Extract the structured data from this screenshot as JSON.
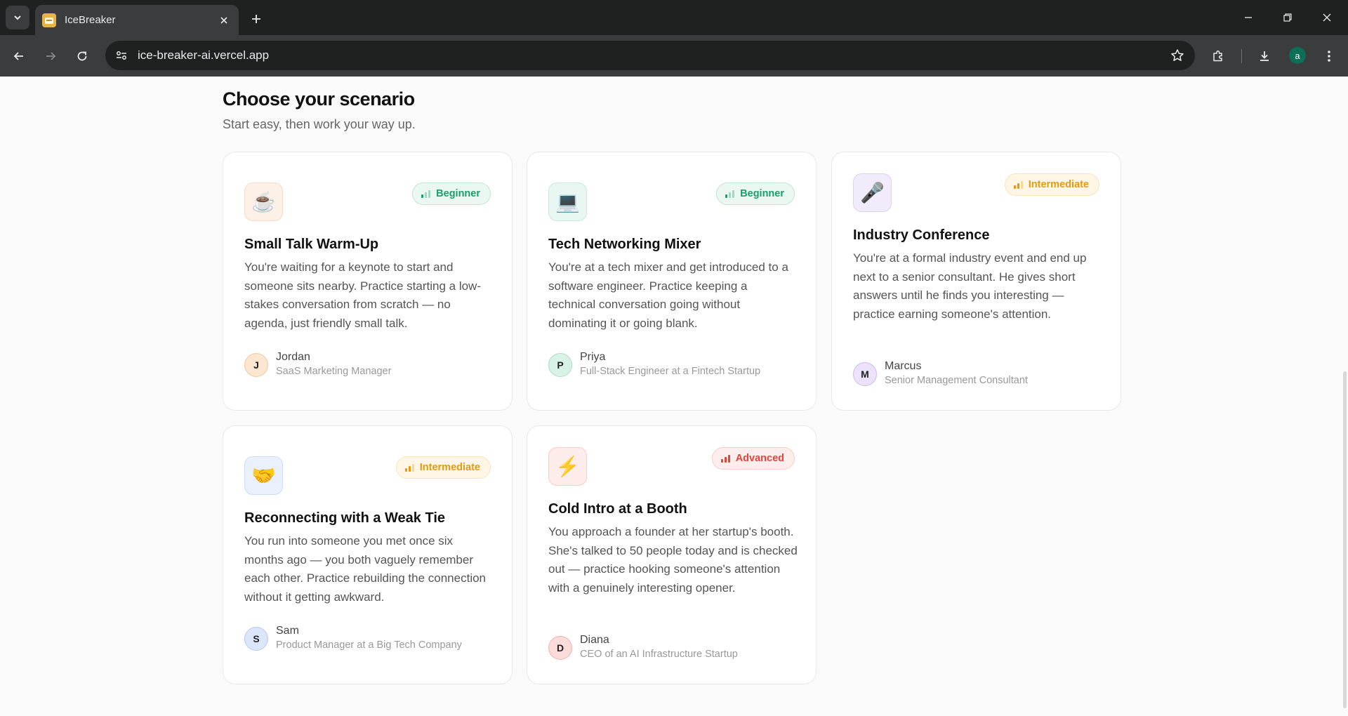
{
  "browser": {
    "tab_title": "IceBreaker",
    "url": "ice-breaker-ai.vercel.app",
    "profile_initial": "a"
  },
  "page": {
    "heading": "Choose your scenario",
    "subheading": "Start easy, then work your way up."
  },
  "scenarios": [
    {
      "icon": "coffee-cup-icon",
      "icon_glyph": "☕",
      "level": "Beginner",
      "title": "Small Talk Warm-Up",
      "description": "You're waiting for a keynote to start and someone sits nearby. Practice starting a low-stakes conversation from scratch — no agenda, just friendly small talk.",
      "persona_initial": "J",
      "persona_name": "Jordan",
      "persona_role": "SaaS Marketing Manager"
    },
    {
      "icon": "laptop-icon",
      "icon_glyph": "💻",
      "level": "Beginner",
      "title": "Tech Networking Mixer",
      "description": "You're at a tech mixer and get introduced to a software engineer. Practice keeping a technical conversation going without dominating it or going blank.",
      "persona_initial": "P",
      "persona_name": "Priya",
      "persona_role": "Full-Stack Engineer at a Fintech Startup"
    },
    {
      "icon": "microphone-icon",
      "icon_glyph": "🎤",
      "level": "Intermediate",
      "title": "Industry Conference",
      "description": "You're at a formal industry event and end up next to a senior consultant. He gives short answers until he finds you interesting — practice earning someone's attention.",
      "persona_initial": "M",
      "persona_name": "Marcus",
      "persona_role": "Senior Management Consultant"
    },
    {
      "icon": "handshake-icon",
      "icon_glyph": "🤝",
      "level": "Intermediate",
      "title": "Reconnecting with a Weak Tie",
      "description": "You run into someone you met once six months ago — you both vaguely remember each other. Practice rebuilding the connection without it getting awkward.",
      "persona_initial": "S",
      "persona_name": "Sam",
      "persona_role": "Product Manager at a Big Tech Company"
    },
    {
      "icon": "lightning-icon",
      "icon_glyph": "⚡",
      "level": "Advanced",
      "title": "Cold Intro at a Booth",
      "description": "You approach a founder at her startup's booth. She's talked to 50 people today and is checked out — practice hooking someone's attention with a genuinely interesting opener.",
      "persona_initial": "D",
      "persona_name": "Diana",
      "persona_role": "CEO of an AI Infrastructure Startup"
    }
  ],
  "colors": {
    "beginner_text": "#1a9e6a",
    "beginner_bg": "#eaf8f1",
    "intermediate_text": "#e69a12",
    "intermediate_bg": "#fff6e6",
    "advanced_text": "#e2453c",
    "advanced_bg": "#fdeeed"
  }
}
